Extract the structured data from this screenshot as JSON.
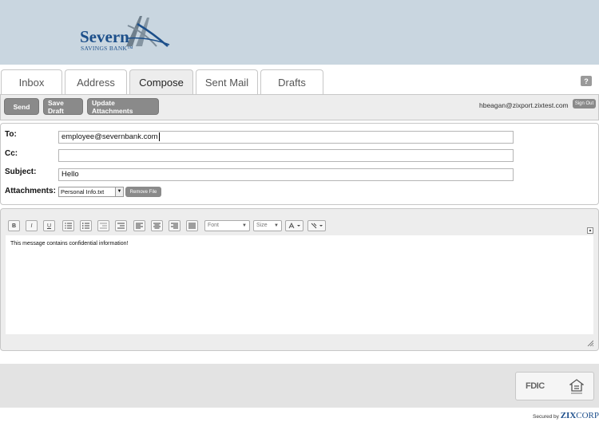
{
  "brand": {
    "name": "Severn",
    "subtitle": "SAVINGS BANK™",
    "primary_color": "#1c4f8a",
    "header_bg": "#c9d6e0"
  },
  "tabs": [
    {
      "label": "Inbox",
      "active": false
    },
    {
      "label": "Address",
      "active": false
    },
    {
      "label": "Compose",
      "active": true
    },
    {
      "label": "Sent Mail",
      "active": false
    },
    {
      "label": "Drafts",
      "active": false
    }
  ],
  "help": {
    "label": "?"
  },
  "toolbar": {
    "send_label": "Send",
    "save_draft_label": "Save Draft",
    "update_attachments_label": "Update Attachments",
    "user_email": "hbeagan@zixport.zixtest.com",
    "sign_out_label": "Sign Out"
  },
  "compose": {
    "to_label": "To:",
    "to_value": "employee@severnbank.com",
    "cc_label": "Cc:",
    "cc_value": "",
    "subject_label": "Subject:",
    "subject_value": "Hello",
    "attachments_label": "Attachments:",
    "attachment_selected": "Personal Info.txt",
    "remove_file_label": "Remove File"
  },
  "editor": {
    "buttons": [
      "B",
      "I",
      "U"
    ],
    "font_label": "Font",
    "size_label": "Size",
    "body_text": "This message contains confidential information!"
  },
  "footer": {
    "fdic_label": "FDIC",
    "secured_by_label": "Secured by",
    "zix_label": "ZIX",
    "corp_label": "CORP"
  }
}
